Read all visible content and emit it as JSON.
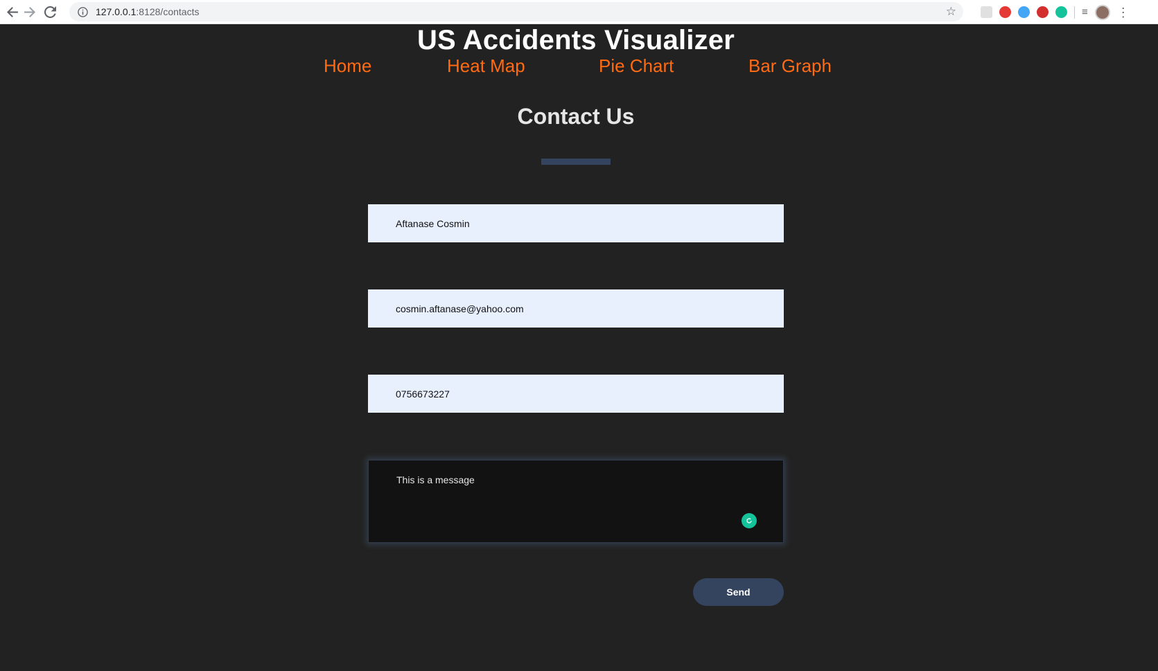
{
  "browser": {
    "url_host": "127.0.0.1",
    "url_rest": ":8128/contacts",
    "icons": [
      "back-icon",
      "forward-icon",
      "reload-icon",
      "info-icon",
      "star-icon",
      "extension-icon",
      "profile-avatar",
      "menu-icon"
    ]
  },
  "site": {
    "title": "US Accidents Visualizer",
    "nav": {
      "home": "Home",
      "heat_map": "Heat Map",
      "pie_chart": "Pie Chart",
      "bar_graph": "Bar Graph"
    },
    "colors": {
      "background": "#222222",
      "nav_link": "#ff6a13",
      "accent": "#34445f",
      "input_bg": "#e8f0fe"
    }
  },
  "contact": {
    "heading": "Contact Us",
    "name_value": "Aftanase Cosmin",
    "email_value": "cosmin.aftanase@yahoo.com",
    "phone_value": "0756673227",
    "message_value": "This is a message",
    "send_label": "Send"
  }
}
